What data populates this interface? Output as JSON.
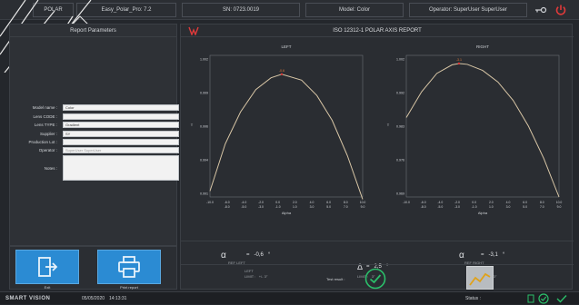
{
  "topbar": {
    "brand": "POLAR",
    "app_version": "Easy_Polar_Pro: 7.2",
    "serial": "SN: 0723.0019",
    "model": "Model: Color",
    "operator": "Operator: SuperUser SuperUser"
  },
  "left_panel": {
    "title": "Report Parameters",
    "fields": [
      {
        "label": "Model name :",
        "value": "Color"
      },
      {
        "label": "Lens CODE :",
        "value": ""
      },
      {
        "label": "Lens TYPE :",
        "value": "Gradient"
      },
      {
        "label": "Supplier :",
        "value": "SY"
      },
      {
        "label": "Production Lot :",
        "value": ""
      },
      {
        "label": "Operator :",
        "value": "SuperUser SuperUser"
      }
    ],
    "notes_label": "Notes :",
    "exit_label": "Exit",
    "print_label": "Print report"
  },
  "report": {
    "title": "ISO 12312-1 POLAR AXIS REPORT",
    "results": {
      "alpha_symbol": "α",
      "alpha_left_sub": "REF LEFT",
      "alpha_left_value": "=   -0,6   °",
      "alpha_right_sub": "REF RIGHT",
      "alpha_right_value": "=   -3,1   °",
      "delta_symbol": "Δ",
      "delta_value": "=   2,5   °",
      "left_caption": "LEFT",
      "left_limit": "LIMIT :   +/- 3°",
      "right_caption": "RIGHT",
      "right_limit": "LIMIT :   +/- 3°",
      "middle_limit": "LIMIT :   3°",
      "test_result_label": "Test result :"
    }
  },
  "chart_data": [
    {
      "type": "line",
      "title": "LEFT",
      "xlabel": "Alpha",
      "ylabel": "T",
      "xlim": [
        -10,
        10
      ],
      "x_ticks_top": [
        "-10.0",
        "-6.0",
        "-4.0",
        "-2.0",
        "0.0",
        "2.0",
        "4.0",
        "6.0",
        "8.0",
        "10.0"
      ],
      "x_ticks_bottom": [
        "-8.0",
        "-5.0",
        "-3.0",
        "-1.0",
        "1.0",
        "3.0",
        "5.0",
        "7.0",
        "9.0"
      ],
      "ylim": [
        0.99,
        1.002
      ],
      "y_ticks": [
        "1.002",
        "0.999",
        "0.996",
        "0.994",
        "0.991"
      ],
      "peak_label": "-0.6",
      "series": [
        {
          "x": [
            -10,
            -8,
            -6,
            -4,
            -2,
            -0.6,
            2,
            4,
            6,
            8,
            10
          ],
          "y": [
            0.9905,
            0.9945,
            0.9972,
            0.9991,
            1.0001,
            1.0004,
            0.9999,
            0.9986,
            0.9965,
            0.9935,
            0.9898
          ]
        }
      ]
    },
    {
      "type": "line",
      "title": "RIGHT",
      "xlabel": "Alpha",
      "ylabel": "T",
      "xlim": [
        -10,
        10
      ],
      "x_ticks_top": [
        "-10.0",
        "-6.0",
        "-4.0",
        "-2.0",
        "0.0",
        "2.0",
        "4.0",
        "6.0",
        "8.0",
        "10.0"
      ],
      "x_ticks_bottom": [
        "-8.0",
        "-5.0",
        "-3.0",
        "-1.0",
        "1.0",
        "3.0",
        "5.0",
        "7.0",
        "9.0"
      ],
      "ylim": [
        0.969,
        1.002
      ],
      "y_ticks": [
        "1.002",
        "0.992",
        "0.983",
        "0.976",
        "0.969"
      ],
      "peak_label": "-3.1",
      "series": [
        {
          "x": [
            -10,
            -8,
            -6,
            -4,
            -3.1,
            -2,
            0,
            2,
            4,
            6,
            8,
            10
          ],
          "y": [
            0.9875,
            0.9935,
            0.9978,
            0.9998,
            1.0001,
            0.9999,
            0.9985,
            0.9958,
            0.9915,
            0.9855,
            0.978,
            0.969
          ]
        }
      ]
    }
  ],
  "bottombar": {
    "brand": "SMART VISION",
    "date": "05/05/2020",
    "time": "14:13:31",
    "status_label": "Status :"
  },
  "colors": {
    "accent_blue": "#2b8bd3",
    "curve": "#d8c6a6",
    "ok_green": "#2bbf6a",
    "red": "#e03a3a"
  }
}
